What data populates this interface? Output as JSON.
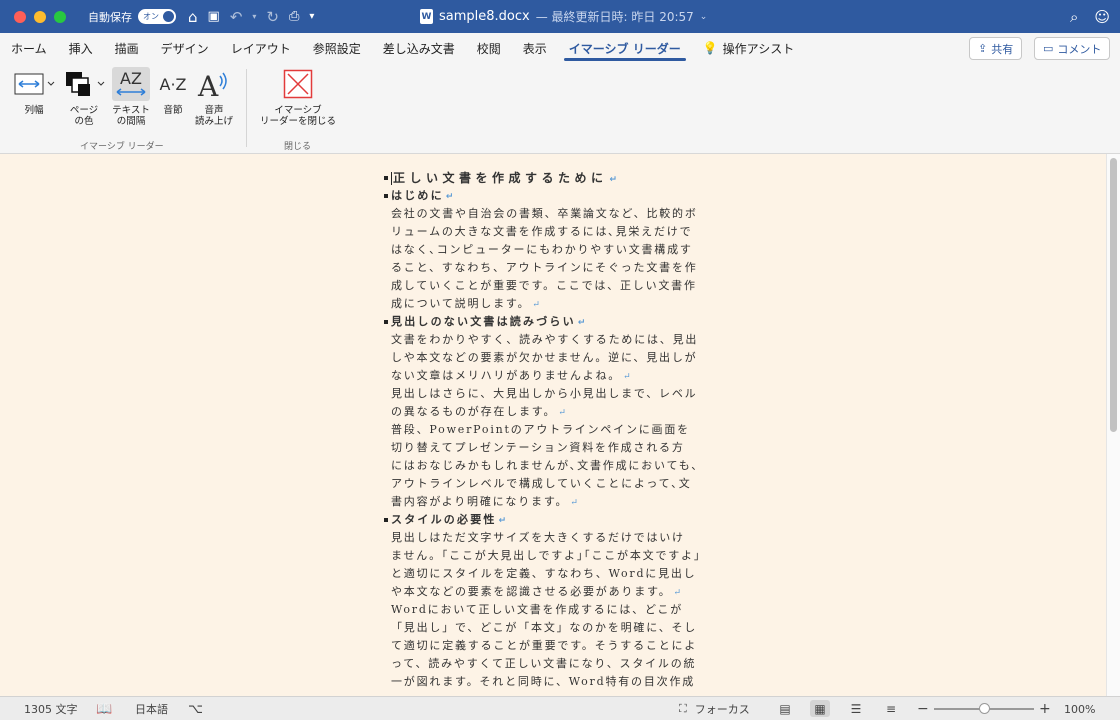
{
  "window": {
    "autosave_label": "自動保存",
    "autosave_state": "オン",
    "file_name": "sample8.docx",
    "modified": "— 最終更新日時: 昨日 20:57"
  },
  "tabs": [
    {
      "label": "ホーム"
    },
    {
      "label": "挿入"
    },
    {
      "label": "描画"
    },
    {
      "label": "デザイン"
    },
    {
      "label": "レイアウト"
    },
    {
      "label": "参照設定"
    },
    {
      "label": "差し込み文書"
    },
    {
      "label": "校閲"
    },
    {
      "label": "表示"
    },
    {
      "label": "イマーシブ リーダー",
      "active": true
    },
    {
      "label": "操作アシスト"
    }
  ],
  "share_label": "共有",
  "comment_label": "コメント",
  "ribbon": {
    "column_width": "列幅",
    "page_color_1": "ページ",
    "page_color_2": "の色",
    "text_spacing_1": "テキスト",
    "text_spacing_2": "の間隔",
    "syllables": "音節",
    "read_aloud_1": "音声",
    "read_aloud_2": "読み上げ",
    "close_1": "イマーシブ",
    "close_2": "リーダーを閉じる",
    "group_reader": "イマーシブ リーダー",
    "group_close": "閉じる",
    "az_glyph": "AZ",
    "az_small": "A·Z"
  },
  "document": {
    "lines": [
      {
        "type": "h1",
        "text": "正しい文書を作成するために"
      },
      {
        "type": "h2",
        "text": "はじめに"
      },
      {
        "type": "p",
        "text": "会社の文書や自治会の書類、卒業論文など、比較的ボ"
      },
      {
        "type": "p",
        "text": "リュームの大きな文書を作成するには､見栄えだけで"
      },
      {
        "type": "p",
        "text": "はなく､コンピューターにもわかりやすい文書構成す"
      },
      {
        "type": "p",
        "text": "ること、すなわち、アウトラインにそぐった文書を作"
      },
      {
        "type": "p",
        "text": "成していくことが重要です。ここでは、正しい文書作"
      },
      {
        "type": "p",
        "text": "成について説明します。",
        "pm": true
      },
      {
        "type": "h2",
        "text": "見出しのない文書は読みづらい"
      },
      {
        "type": "p",
        "text": "文書をわかりやすく、読みやすくするためには、見出"
      },
      {
        "type": "p",
        "text": "しや本文などの要素が欠かせません。逆に、見出しが"
      },
      {
        "type": "p",
        "text": "ない文章はメリハリがありませんよね。",
        "pm": true
      },
      {
        "type": "p",
        "text": "見出しはさらに、大見出しから小見出しまで、レベル"
      },
      {
        "type": "p",
        "text": "の異なるものが存在します。",
        "pm": true
      },
      {
        "type": "p",
        "text": "普段、PowerPointのアウトラインペインに画面を"
      },
      {
        "type": "p",
        "text": "切り替えてプレゼンテーション資料を作成される方"
      },
      {
        "type": "p",
        "text": "にはおなじみかもしれませんが､文書作成においても､"
      },
      {
        "type": "p",
        "text": "アウトラインレベルで構成していくことによって､文"
      },
      {
        "type": "p",
        "text": "書内容がより明確になります。",
        "pm": true
      },
      {
        "type": "h2",
        "text": "スタイルの必要性"
      },
      {
        "type": "p",
        "text": "見出しはただ文字サイズを大きくするだけではいけ"
      },
      {
        "type": "p",
        "text": "ません。｢ここが大見出しですよ｣｢ここが本文ですよ｣"
      },
      {
        "type": "p",
        "text": "と適切にスタイルを定義、すなわち、Wordに見出し"
      },
      {
        "type": "p",
        "text": "や本文などの要素を認識させる必要があります。",
        "pm": true
      },
      {
        "type": "p",
        "text": "Wordにおいて正しい文書を作成するには、どこが"
      },
      {
        "type": "p",
        "text": "「見出し」で、どこが「本文」なのかを明確に、そし"
      },
      {
        "type": "p",
        "text": "て適切に定義することが重要です。そうすることによ"
      },
      {
        "type": "p",
        "text": "って、読みやすくて正しい文書になり、スタイルの統"
      },
      {
        "type": "p",
        "text": "一が図れます。それと同時に、Word特有の目次作成"
      }
    ]
  },
  "status": {
    "word_count": "1305 文字",
    "language": "日本語",
    "focus": "フォーカス",
    "zoom": "100%",
    "zoom_level": 100
  }
}
